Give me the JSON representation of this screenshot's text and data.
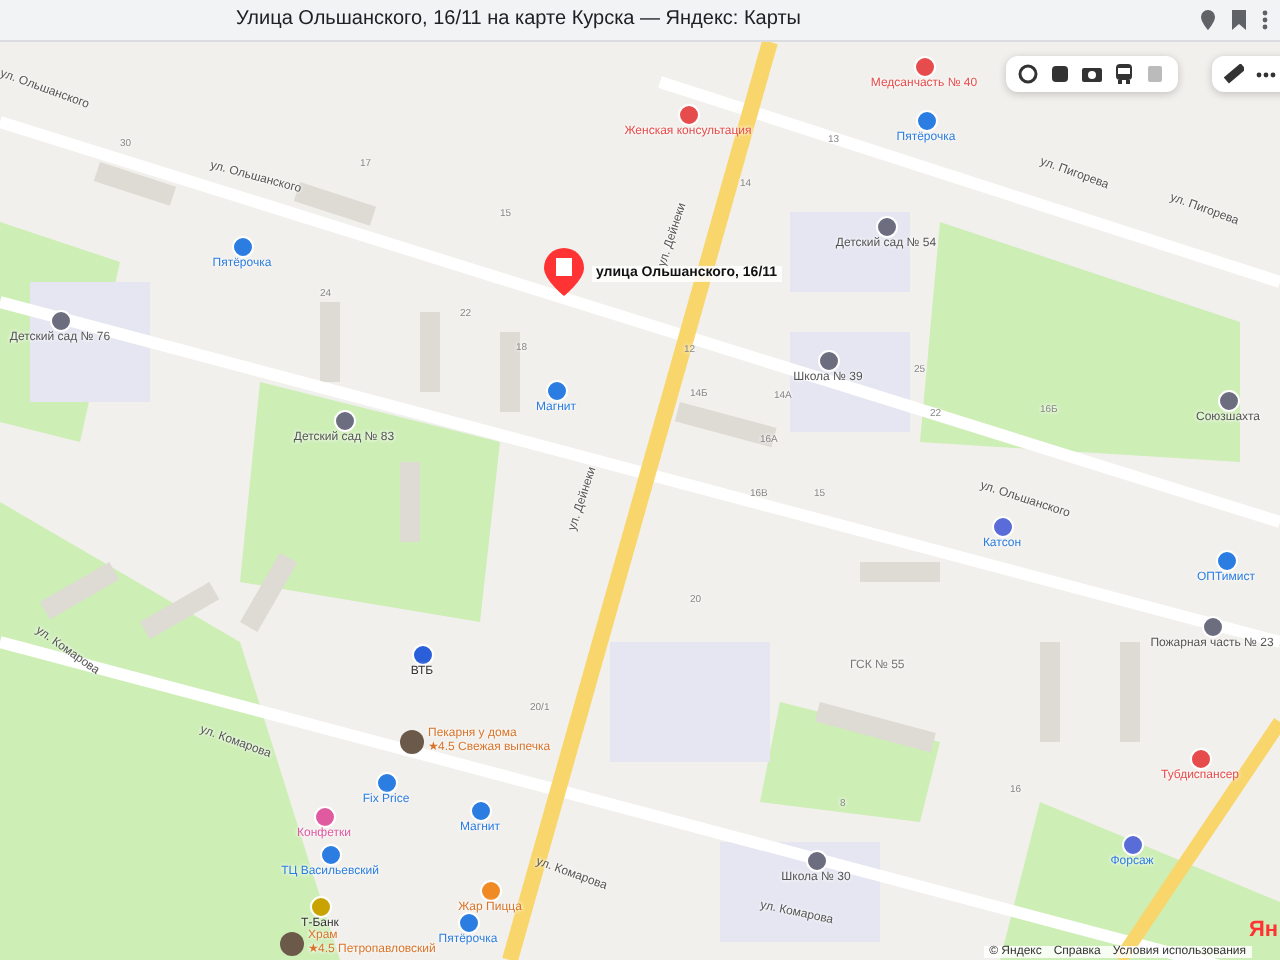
{
  "browser": {
    "title": "Улица Ольшанского, 16/11 на карте Курска — Яндекс: Карты"
  },
  "place_pin": {
    "label": "улица Ольшанского, 16/11"
  },
  "streets": [
    {
      "name": "ул. Ольшанского"
    },
    {
      "name": "ул. Ольшанского"
    },
    {
      "name": "ул. Дейнеки"
    },
    {
      "name": "ул. Пигорева"
    },
    {
      "name": "ул. Пигорева"
    },
    {
      "name": "ул. Дейнеки"
    },
    {
      "name": "ул. Ольшанского"
    },
    {
      "name": "ул. Комарова"
    },
    {
      "name": "ул. Комарова"
    },
    {
      "name": "ул. Комарова"
    },
    {
      "name": "ул. Комарова"
    }
  ],
  "pois": [
    {
      "kind": "shop",
      "name": "Пятёрочка"
    },
    {
      "kind": "school",
      "name": "Детский сад № 76"
    },
    {
      "kind": "school",
      "name": "Детский сад № 83"
    },
    {
      "kind": "shop",
      "name": "Магнит"
    },
    {
      "kind": "medical",
      "name": "Женская консультация"
    },
    {
      "kind": "medical",
      "name": "Медсанчасть № 40"
    },
    {
      "kind": "shop",
      "name": "Пятёрочка"
    },
    {
      "kind": "school",
      "name": "Детский сад № 54"
    },
    {
      "kind": "school",
      "name": "Школа № 39"
    },
    {
      "kind": "school",
      "name": "Союзшахта"
    },
    {
      "kind": "car",
      "name": "Катсон"
    },
    {
      "kind": "shop",
      "name": "ОПТимист"
    },
    {
      "kind": "school",
      "name": "Пожарная часть № 23"
    },
    {
      "kind": "medical",
      "name": "Тубдиспансер"
    },
    {
      "kind": "car",
      "name": "Форсаж"
    },
    {
      "kind": "school",
      "name": "Школа № 30"
    },
    {
      "kind": "bank",
      "name": "ВТБ"
    },
    {
      "kind": "photo",
      "name": "Пекарня у дома",
      "subtitle": "★4.5 Свежая выпечка"
    },
    {
      "kind": "shop",
      "name": "Fix Price"
    },
    {
      "kind": "shop",
      "name": "Магнит"
    },
    {
      "kind": "beauty",
      "name": "Конфетки"
    },
    {
      "kind": "shop",
      "name": "ТЦ Васильевский"
    },
    {
      "kind": "tbank",
      "name": "Т-Банк"
    },
    {
      "kind": "food",
      "name": "Жар Пицца"
    },
    {
      "kind": "shop",
      "name": "Пятёрочка"
    },
    {
      "kind": "photo",
      "name": "Храм",
      "subtitle": "★4.5 Петропавловский"
    }
  ],
  "areas": [
    {
      "name": "ГСК № 55"
    }
  ],
  "house_numbers": [
    "30",
    "17",
    "15",
    "24",
    "22",
    "18",
    "13",
    "14",
    "14Б",
    "14А",
    "12",
    "25",
    "22",
    "16Б",
    "16В",
    "16А",
    "15",
    "20",
    "16",
    "8",
    "20/1"
  ],
  "footer": {
    "links": [
      "© Яндекс",
      "Справка",
      "Условия использования"
    ]
  },
  "logo": "Ян"
}
